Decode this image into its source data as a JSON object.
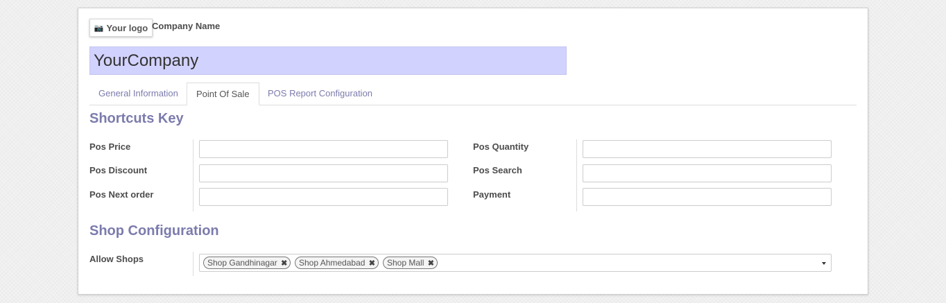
{
  "header": {
    "logo_icon": "camera-icon",
    "logo_text": "Your logo",
    "company_label": "Company Name",
    "company_value": "YourCompany"
  },
  "tabs": [
    {
      "label": "General Information",
      "active": false
    },
    {
      "label": "Point Of Sale",
      "active": true
    },
    {
      "label": "POS Report Configuration",
      "active": false
    }
  ],
  "shortcuts": {
    "title": "Shortcuts Key",
    "left": [
      {
        "label": "Pos Price",
        "value": ""
      },
      {
        "label": "Pos Discount",
        "value": ""
      },
      {
        "label": "Pos Next order",
        "value": ""
      }
    ],
    "right": [
      {
        "label": "Pos Quantity",
        "value": ""
      },
      {
        "label": "Pos Search",
        "value": ""
      },
      {
        "label": "Payment",
        "value": ""
      }
    ]
  },
  "shop_config": {
    "title": "Shop Configuration",
    "allow_shops_label": "Allow Shops",
    "tags": [
      "Shop Gandhinagar",
      "Shop Ahmedabad",
      "Shop Mall"
    ],
    "remove_glyph": "✖"
  },
  "colors": {
    "accent": "#7c7bad",
    "company_input_bg": "#d2d2ff"
  }
}
